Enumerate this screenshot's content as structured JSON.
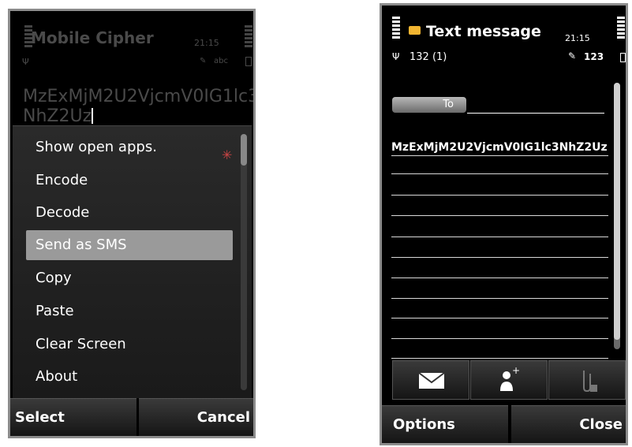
{
  "phone1": {
    "app_title": "Mobile Cipher",
    "time": "21:15",
    "input_mode": "abc",
    "cipher_text": "MzExMjM2U2VjcmV0IG1lc3NhZ2Uz",
    "menu": {
      "items": [
        {
          "label": "Show open apps."
        },
        {
          "label": "Encode"
        },
        {
          "label": "Decode"
        },
        {
          "label": "Send as SMS"
        },
        {
          "label": "Copy"
        },
        {
          "label": "Paste"
        },
        {
          "label": "Clear Screen"
        },
        {
          "label": "About"
        }
      ],
      "selected": "Send as SMS"
    },
    "softkeys": {
      "left": "Select",
      "right": "Cancel"
    }
  },
  "phone2": {
    "title": "Text message",
    "time": "21:15",
    "char_count": "132 (1)",
    "input_mode": "123",
    "to_label": "To",
    "message_text": "MzExMjM2U2VjcmV0IG1lc3NhZ2Uz",
    "toolbar": [
      {
        "icon": "envelope-icon"
      },
      {
        "icon": "add-contact-icon"
      },
      {
        "icon": "attachment-icon"
      }
    ],
    "softkeys": {
      "left": "Options",
      "right": "Close"
    }
  }
}
